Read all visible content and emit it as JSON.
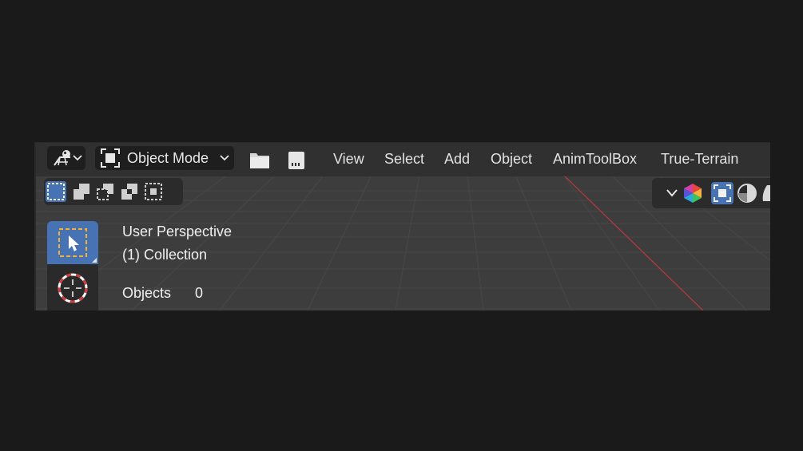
{
  "header": {
    "mode_label": "Object Mode",
    "menus": [
      "View",
      "Select",
      "Add",
      "Object",
      "AnimToolBox",
      "True-Terrain"
    ]
  },
  "icons": {
    "editor_type": "3d-viewport-icon",
    "mode": "object-mode-icon",
    "open": "folder-icon",
    "save": "save-icon",
    "select_box_modes": [
      "select-box-new-icon",
      "select-box-extend-icon",
      "select-box-subtract-icon",
      "select-box-invert-icon",
      "select-box-intersect-icon"
    ],
    "shading": [
      "viewport-gizmo-icon",
      "wireframe-toggle-icon",
      "solid-shading-icon",
      "material-shading-icon"
    ]
  },
  "overlay": {
    "view_name": "User Perspective",
    "collection": "(1) Collection",
    "objects_label": "Objects",
    "objects_count": "0"
  },
  "colors": {
    "accent": "#4772b3",
    "viewport_bg": "#3d3d3d",
    "header_bg": "#303030",
    "x_axis": "#b83a3e"
  }
}
